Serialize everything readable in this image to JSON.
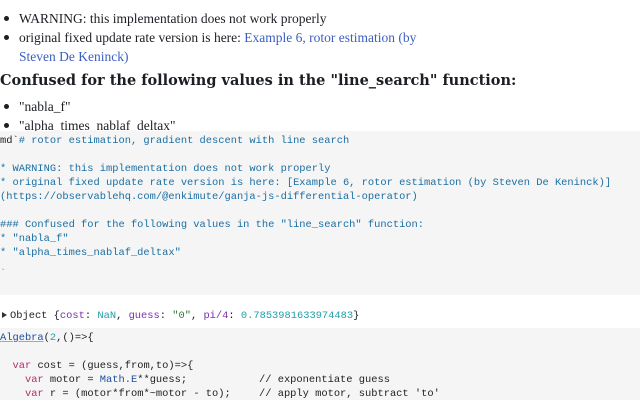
{
  "rendered_md": {
    "warning_item": "WARNING: this implementation does not work properly",
    "original_item_text": "original fixed update rate version is here: ",
    "original_item_link_line1": "Example 6, rotor estimation (by",
    "original_item_link_line2": "Steven De Keninck)",
    "heading": "Confused for the following values in the \"line_search\" function:",
    "value_items": [
      "\"nabla_f\"",
      "\"alpha_times_nablaf_deltax\""
    ]
  },
  "md_cell": {
    "prefix": "md`",
    "lines": [
      "# rotor estimation, gradient descent with line search",
      "",
      "* WARNING: this implementation does not work properly",
      "* original fixed update rate version is here: [Example 6, rotor estimation (by Steven De Keninck)]",
      "(https://observablehq.com/@enkimute/ganja-js-differential-operator)",
      "",
      "### Confused for the following values in the \"line_search\" function:",
      "* \"nabla_f\"",
      "* \"alpha_times_nablaf_deltax\""
    ],
    "closing": "`"
  },
  "output": {
    "label": "Object",
    "open": "{",
    "k1": "cost",
    "v1": "NaN",
    "k2": "guess",
    "v2": "\"0\"",
    "k3": "pi/4",
    "v3": "0.7853981633974483",
    "close": "}"
  },
  "js_cell": {
    "l1_fn": "Algebra",
    "l1_rest_a": "(",
    "l1_num": "2",
    "l1_rest_b": ",()=>{",
    "l3_kw": "var",
    "l3_rest": " cost = (guess,from,to)=>{",
    "l4_kw": "var",
    "l4_a": " motor = ",
    "l4_prop": "Math.E",
    "l4_b": "**guess;",
    "l4_comment": "// exponentiate guess",
    "l5_kw": "var",
    "l5_a": " r = (motor*from*~motor - to);",
    "l5_comment": "// apply motor, subtract 'to'"
  }
}
